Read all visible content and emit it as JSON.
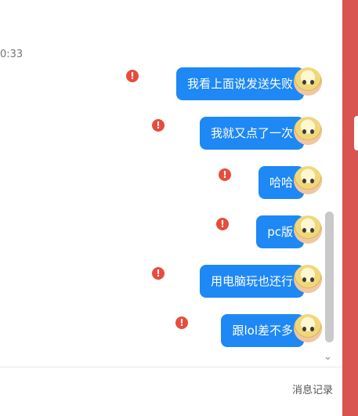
{
  "timestamp": "0:33",
  "messages": [
    {
      "text": "我看上面说发送失败",
      "error_icon": "!"
    },
    {
      "text": "我就又点了一次",
      "error_icon": "!"
    },
    {
      "text": "哈哈",
      "error_icon": "!"
    },
    {
      "text": "pc版",
      "error_icon": "!"
    },
    {
      "text": "用电脑玩也还行",
      "error_icon": "!"
    },
    {
      "text": "跟lol差不多",
      "error_icon": "!"
    }
  ],
  "footer": {
    "history_label": "消息记录",
    "caret": "▼"
  },
  "scroll": {
    "down_symbol": "⌄"
  },
  "colors": {
    "bubble": "#1e88f5",
    "error": "#e74c3c",
    "side_panel": "#d9534f"
  },
  "icons": [
    "error-icon",
    "avatar",
    "scroll-down-icon",
    "dropdown-caret-icon"
  ]
}
